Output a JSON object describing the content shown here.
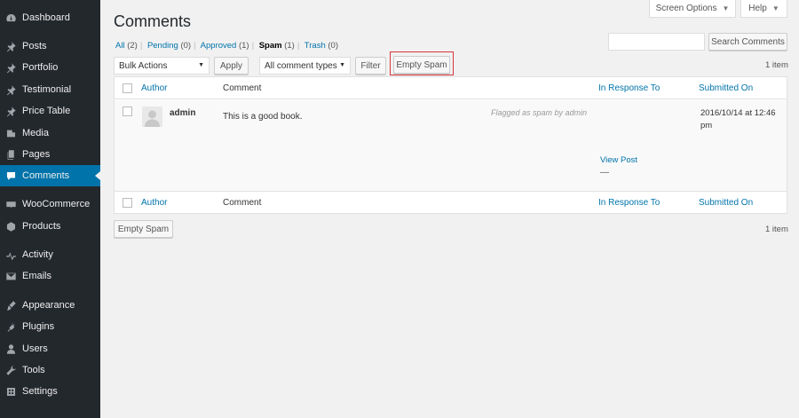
{
  "sidebar": {
    "items": [
      {
        "label": "Dashboard",
        "icon": "dashboard-icon"
      },
      {
        "label": "Posts",
        "icon": "pin-icon"
      },
      {
        "label": "Portfolio",
        "icon": "pin-icon"
      },
      {
        "label": "Testimonial",
        "icon": "pin-icon"
      },
      {
        "label": "Price Table",
        "icon": "pin-icon"
      },
      {
        "label": "Media",
        "icon": "media-icon"
      },
      {
        "label": "Pages",
        "icon": "pages-icon"
      },
      {
        "label": "Comments",
        "icon": "comments-icon",
        "active": true
      },
      {
        "label": "WooCommerce",
        "icon": "woocommerce-icon"
      },
      {
        "label": "Products",
        "icon": "products-icon"
      },
      {
        "label": "Activity",
        "icon": "activity-icon"
      },
      {
        "label": "Emails",
        "icon": "email-icon"
      },
      {
        "label": "Appearance",
        "icon": "brush-icon"
      },
      {
        "label": "Plugins",
        "icon": "plug-icon"
      },
      {
        "label": "Users",
        "icon": "users-icon"
      },
      {
        "label": "Tools",
        "icon": "wrench-icon"
      },
      {
        "label": "Settings",
        "icon": "settings-icon"
      }
    ]
  },
  "header": {
    "screen_options": "Screen Options",
    "help": "Help",
    "title": "Comments"
  },
  "filters": {
    "all": "All",
    "all_count": "(2)",
    "pending": "Pending",
    "pending_count": "(0)",
    "approved": "Approved",
    "approved_count": "(1)",
    "spam": "Spam",
    "spam_count": "(1)",
    "trash": "Trash",
    "trash_count": "(0)"
  },
  "search": {
    "value": "",
    "button": "Search Comments"
  },
  "toolbar": {
    "bulk_actions": "Bulk Actions",
    "apply": "Apply",
    "comment_types": "All comment types",
    "filter": "Filter",
    "empty_spam": "Empty Spam",
    "items_count": "1 item"
  },
  "table": {
    "columns": {
      "author": "Author",
      "comment": "Comment",
      "in_response_to": "In Response To",
      "submitted_on": "Submitted On"
    },
    "rows": [
      {
        "author": "admin",
        "comment": "This is a good book.",
        "flag": "Flagged as spam by admin",
        "view_post": "View Post",
        "dash": "—",
        "date": "2016/10/14 at 12:46 pm"
      }
    ]
  },
  "footer": {
    "empty_spam": "Empty Spam",
    "items_count": "1 item"
  },
  "colors": {
    "sidebar": "#23282d",
    "accent": "#0073aa",
    "highlight": "#d63638"
  }
}
